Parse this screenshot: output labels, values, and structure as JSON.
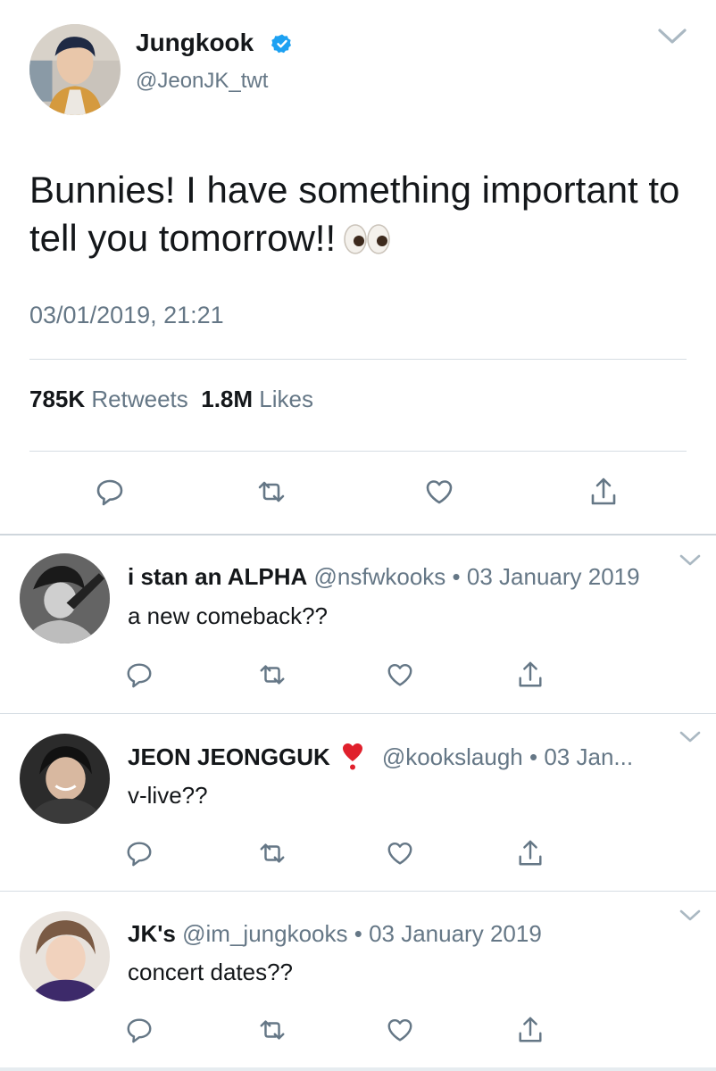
{
  "main_tweet": {
    "author_name": "Jungkook",
    "handle": "@JeonJK_twt",
    "text": "Bunnies! I have something important to tell you tomorrow!!",
    "emoji": "eyes-emoji",
    "timestamp": "03/01/2019, 21:21",
    "retweets_count": "785K",
    "retweets_label": "Retweets",
    "likes_count": "1.8M",
    "likes_label": "Likes",
    "verified": true
  },
  "replies": [
    {
      "name": "i stan an ALPHA",
      "handle": "@nsfwkooks",
      "separator": "•",
      "date": "03 January 2019",
      "text": "a new comeback??"
    },
    {
      "name": "JEON JEONGGUK",
      "name_emoji": "red-exclamation-heart-emoji",
      "handle": "@kookslaugh",
      "separator": "•",
      "date": "03 Jan...",
      "text": "v-live??"
    },
    {
      "name": "JK's",
      "handle": "@im_jungkooks",
      "separator": "•",
      "date": "03 January 2019",
      "text": "concert dates??"
    }
  ],
  "icons": [
    "reply-icon",
    "retweet-icon",
    "like-icon",
    "share-icon",
    "chevron-down-icon",
    "verified-badge-icon"
  ],
  "colors": {
    "text_primary": "#14171a",
    "text_secondary": "#657786",
    "icon": "#657786",
    "verified_blue": "#1da1f2",
    "divider": "#d6dde3"
  }
}
